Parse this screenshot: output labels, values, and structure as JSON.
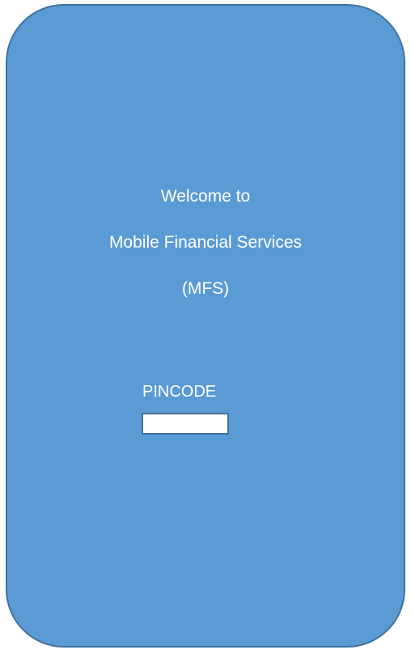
{
  "welcome": {
    "line1": "Welcome to",
    "line2": "Mobile Financial Services",
    "line3": "(MFS)"
  },
  "pincode": {
    "label": "PINCODE",
    "value": "",
    "placeholder": ""
  },
  "colors": {
    "screen_fill": "#5b9bd5",
    "screen_border": "#41719c",
    "text": "#ffffff",
    "input_fill": "#ffffff"
  }
}
